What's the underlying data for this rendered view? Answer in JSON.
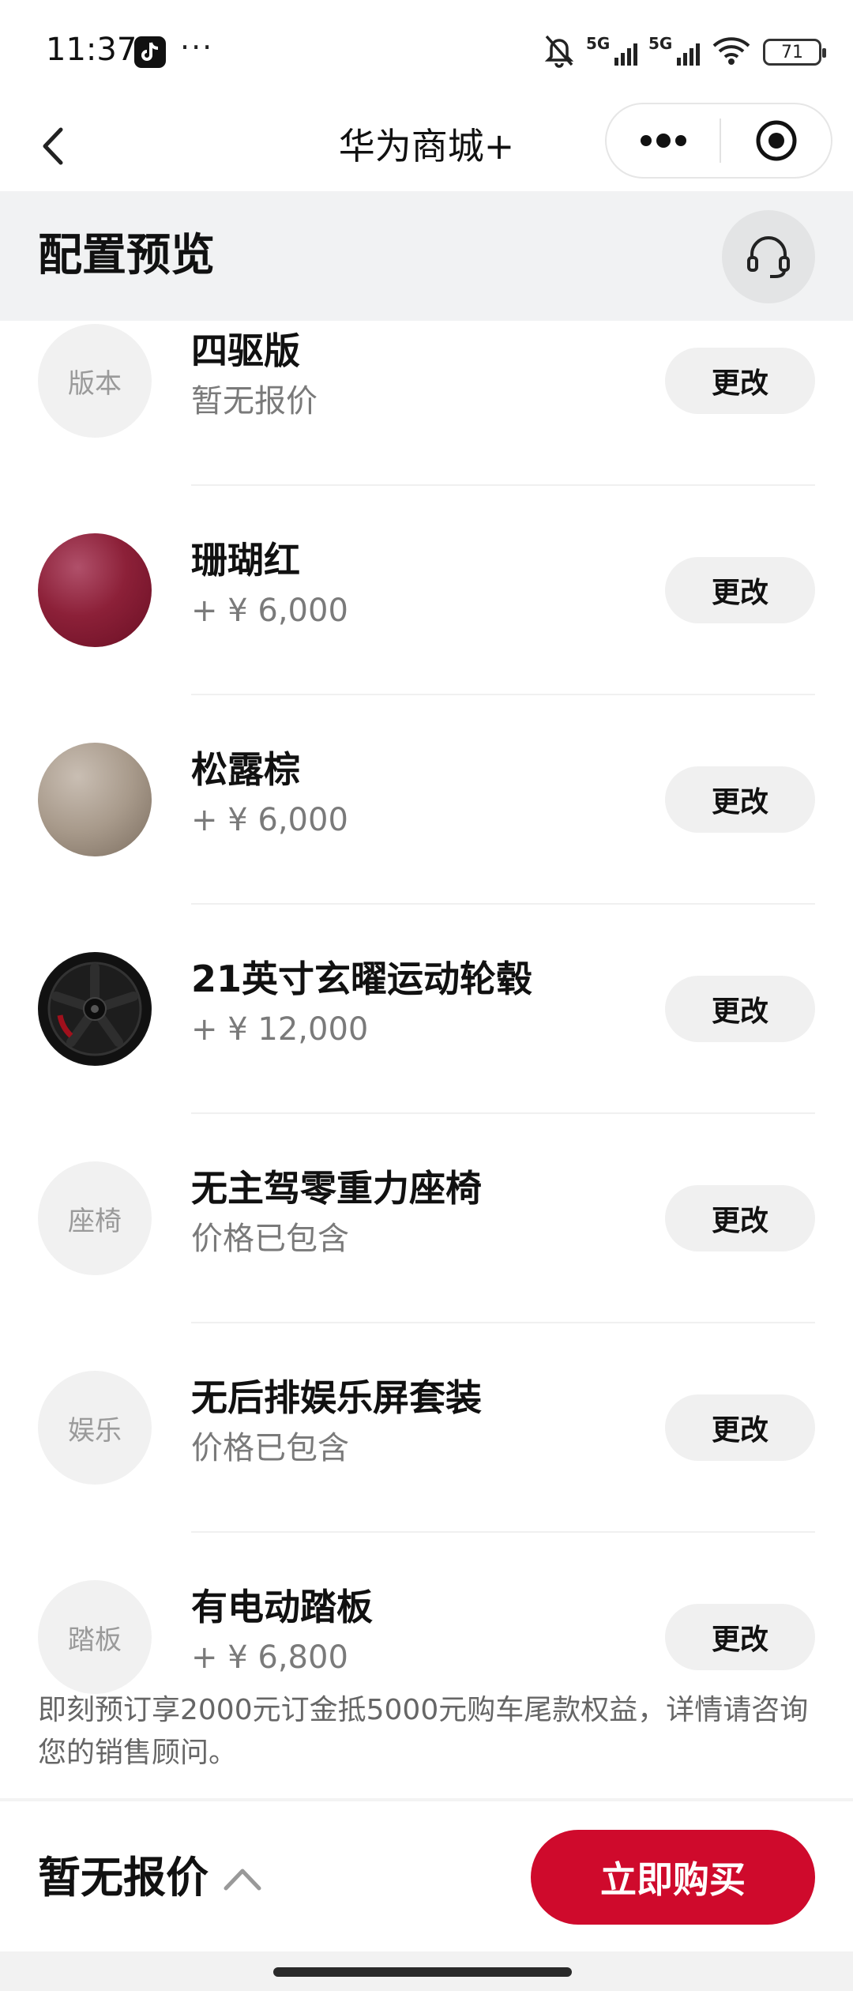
{
  "status_bar": {
    "time": "11:37",
    "dots": "···",
    "network1": "5G",
    "network2": "5G",
    "battery": "71",
    "icons": [
      "tiktok-icon",
      "mute-bell-icon",
      "signal-icon",
      "wifi-icon",
      "battery-icon"
    ]
  },
  "nav": {
    "title": "华为商城+",
    "back_icon": "chevron-left-icon",
    "more_icon": "more-dots-icon",
    "target_icon": "target-icon"
  },
  "section": {
    "title": "配置预览",
    "support_icon": "headset-icon"
  },
  "items": [
    {
      "thumb_text": "版本",
      "name": "四驱版",
      "price": "暂无报价",
      "button": "更改"
    },
    {
      "thumb_text": "",
      "name": "珊瑚红",
      "price": "+ ¥ 6,000",
      "button": "更改"
    },
    {
      "thumb_text": "",
      "name": "松露棕",
      "price": "+ ¥ 6,000",
      "button": "更改"
    },
    {
      "thumb_text": "",
      "name": "21英寸玄曜运动轮毂",
      "price": "+ ¥ 12,000",
      "button": "更改"
    },
    {
      "thumb_text": "座椅",
      "name": "无主驾零重力座椅",
      "price": "价格已包含",
      "button": "更改"
    },
    {
      "thumb_text": "娱乐",
      "name": "无后排娱乐屏套装",
      "price": "价格已包含",
      "button": "更改"
    },
    {
      "thumb_text": "踏板",
      "name": "有电动踏板",
      "price": "+ ¥ 6,800",
      "button": "更改"
    }
  ],
  "notice": "即刻预订享2000元订金抵5000元购车尾款权益，详情请咨询您的销售顾问。",
  "bottom": {
    "total": "暂无报价",
    "buy": "立即购买"
  },
  "colors": {
    "accent": "#cf0a2c",
    "coral_red": "#8c2038",
    "truffle_brown": "#a89a8b"
  }
}
